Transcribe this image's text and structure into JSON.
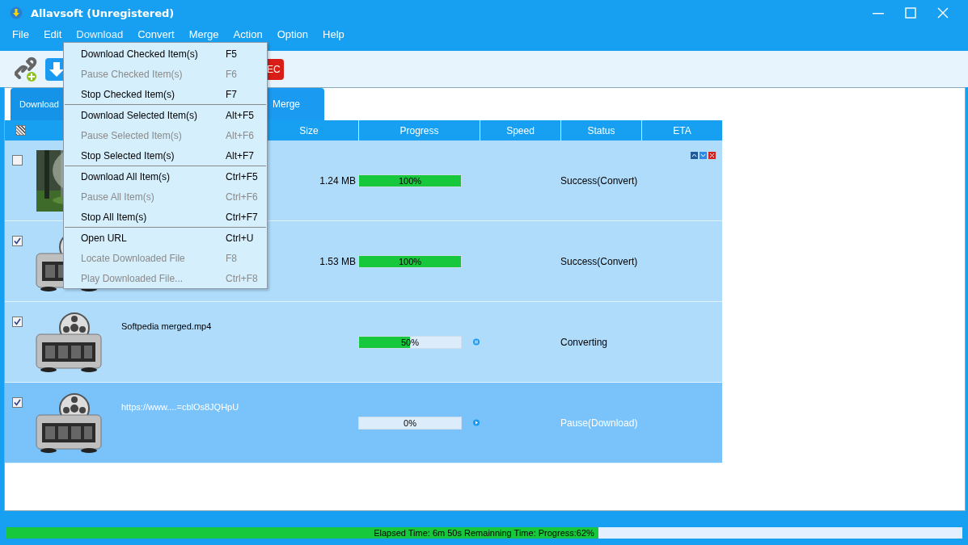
{
  "window": {
    "title": "Allavsoft (Unregistered)"
  },
  "menu_bar": [
    {
      "label": "File",
      "selected": false
    },
    {
      "label": "Edit",
      "selected": false
    },
    {
      "label": "Download",
      "selected": true
    },
    {
      "label": "Convert",
      "selected": false
    },
    {
      "label": "Merge",
      "selected": false
    },
    {
      "label": "Action",
      "selected": false
    },
    {
      "label": "Option",
      "selected": false
    },
    {
      "label": "Help",
      "selected": false
    }
  ],
  "toolbar": {
    "badge": "EC"
  },
  "tabs": [
    {
      "label": "Download",
      "selected": true
    },
    {
      "label": "Merge",
      "selected": false
    }
  ],
  "table": {
    "header_checked": true,
    "columns": [
      "Size",
      "Progress",
      "Speed",
      "Status",
      "ETA"
    ],
    "rows": [
      {
        "kind": "picture",
        "checked": false,
        "selected": false,
        "size": "1.24 MB",
        "level": 1,
        "progress": "100%",
        "running": false,
        "paused": false,
        "status": "Success(Convert)",
        "row_controls": true
      },
      {
        "kind": "film",
        "checked": true,
        "selected": false,
        "size": "1.53 MB",
        "level": 1,
        "progress": "100%",
        "running": false,
        "paused": false,
        "status": "Success(Convert)",
        "row_controls": false
      },
      {
        "kind": "film",
        "checked": true,
        "selected": false,
        "name": "Softpedia merged.mp4",
        "level": 0.5,
        "progress": "50%",
        "running": true,
        "paused": false,
        "status": "Converting",
        "row_controls": false
      },
      {
        "kind": "film",
        "checked": true,
        "selected": true,
        "name": "https://www....=cblOs8JQHpU",
        "level": 0,
        "progress": "0%",
        "running": false,
        "paused": true,
        "status": "Pause(Download)",
        "row_controls": false
      }
    ]
  },
  "dropdown_menu": [
    [
      {
        "label": "Download Checked Item(s)",
        "shortcut": "F5",
        "disabled": false
      },
      {
        "label": "Pause Checked Item(s)",
        "shortcut": "F6",
        "disabled": true
      },
      {
        "label": "Stop Checked Item(s)",
        "shortcut": "F7",
        "disabled": false
      }
    ],
    [
      {
        "label": "Download Selected Item(s)",
        "shortcut": "Alt+F5",
        "disabled": false
      },
      {
        "label": "Pause Selected Item(s)",
        "shortcut": "Alt+F6",
        "disabled": true
      },
      {
        "label": "Stop Selected Item(s)",
        "shortcut": "Alt+F7",
        "disabled": false
      }
    ],
    [
      {
        "label": "Download All Item(s)",
        "shortcut": "Ctrl+F5",
        "disabled": false
      },
      {
        "label": "Pause All Item(s)",
        "shortcut": "Ctrl+F6",
        "disabled": true
      },
      {
        "label": "Stop All Item(s)",
        "shortcut": "Ctrl+F7",
        "disabled": false
      }
    ],
    [
      {
        "label": "Open URL",
        "shortcut": "Ctrl+U",
        "disabled": false
      },
      {
        "label": "Locate Downloaded File",
        "shortcut": "F8",
        "disabled": true
      },
      {
        "label": "Play Downloaded File...",
        "shortcut": "Ctrl+F8",
        "disabled": true
      }
    ]
  ],
  "status_bar": {
    "text": "Elapsed Time: 6m 50s Remainning Time: Progress:62%",
    "level": 0.62
  }
}
